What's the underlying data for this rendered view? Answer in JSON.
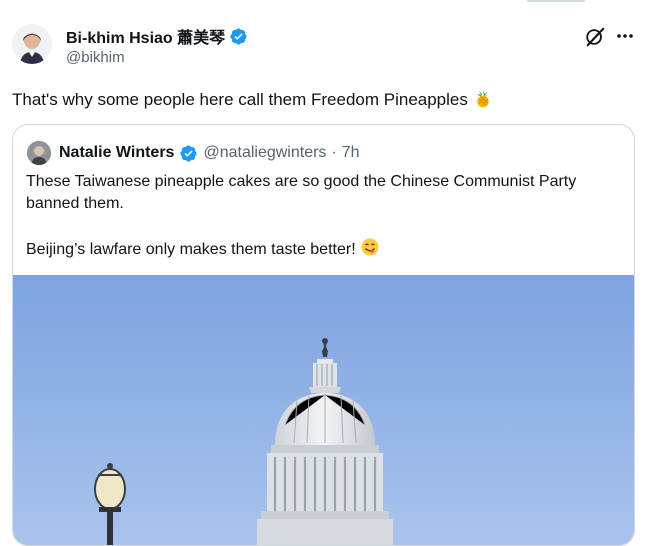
{
  "author": {
    "name": "Bi-khim Hsiao 蕭美琴",
    "handle": "@bikhim"
  },
  "tweet": {
    "text": "That's why some people here call them Freedom Pineapples"
  },
  "quoted": {
    "name": "Natalie Winters",
    "handle": "@nataliegwinters",
    "separator": "·",
    "time": "7h",
    "paragraph1": "These Taiwanese pineapple cakes are so good the Chinese Communist Party banned them.",
    "paragraph2": "Beijing’s lawfare only makes them taste better!"
  },
  "icons": {
    "verified": "verified-badge-icon",
    "grok": "grok-icon",
    "more": "more-options-icon",
    "pineapple": "pineapple-emoji",
    "yum": "yum-face-emoji"
  },
  "colors": {
    "verified": "#1d9bf0",
    "secondary_text": "#536471",
    "border": "#cfd9de"
  }
}
